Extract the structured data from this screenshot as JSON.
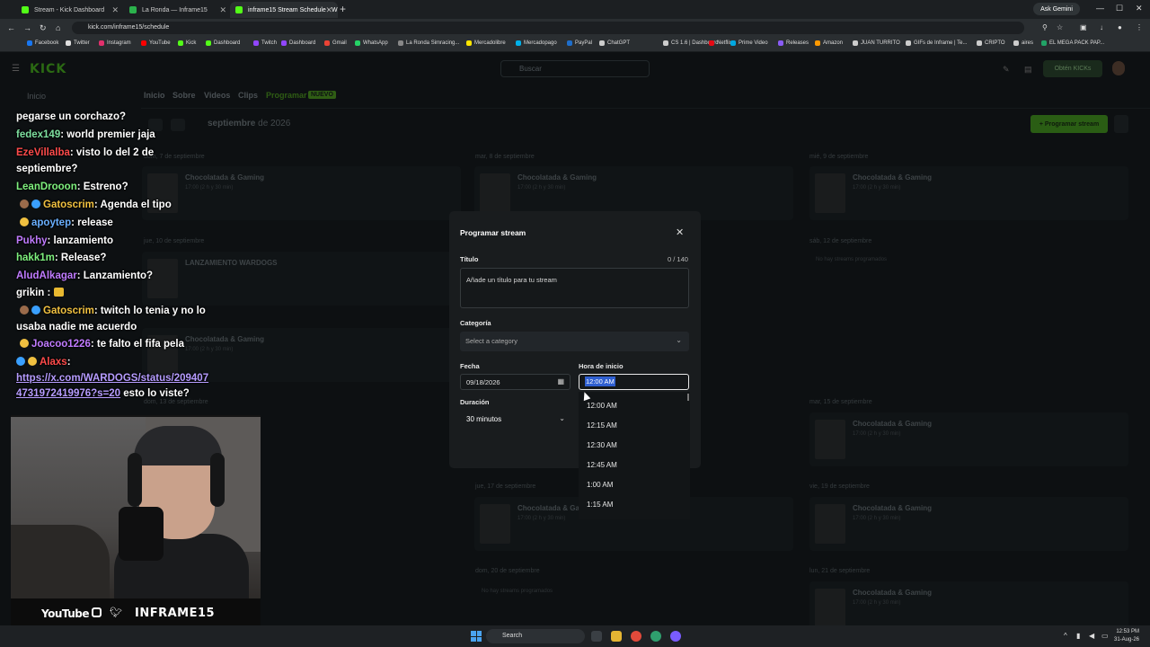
{
  "browser": {
    "tabs": [
      {
        "label": "Stream - Kick Dashboard"
      },
      {
        "label": "La Ronda — Inframe15"
      },
      {
        "label": "inframe15 Stream Schedule - W"
      }
    ],
    "gemini_label": "Ask Gemini",
    "url": "kick.com/inframe15/schedule",
    "bookmarks": [
      {
        "label": "Facebook",
        "color": "#1877f2"
      },
      {
        "label": "Twitter",
        "color": "#dddddd"
      },
      {
        "label": "Instagram",
        "color": "#e1306c"
      },
      {
        "label": "YouTube",
        "color": "#ff0000"
      },
      {
        "label": "Kick",
        "color": "#53fc18"
      },
      {
        "label": "Dashboard",
        "color": "#53fc18"
      },
      {
        "label": "Twitch",
        "color": "#9146ff"
      },
      {
        "label": "Dashboard",
        "color": "#9146ff"
      },
      {
        "label": "Gmail",
        "color": "#ea4335"
      },
      {
        "label": "WhatsApp",
        "color": "#25d366"
      },
      {
        "label": "La Ronda Simracing...",
        "color": "#888888"
      },
      {
        "label": "Mercadolibre",
        "color": "#ffe600"
      },
      {
        "label": "Mercadopago",
        "color": "#00b1ea"
      },
      {
        "label": "PayPal",
        "color": "#1e6ecb"
      },
      {
        "label": "ChatGPT",
        "color": "#cccccc"
      },
      {
        "label": "CS 1.6 | Dashboard",
        "color": "#cccccc"
      },
      {
        "label": "Netflix",
        "color": "#e50914"
      },
      {
        "label": "Prime Video",
        "color": "#00a8e1"
      },
      {
        "label": "Releases",
        "color": "#8a5cf6"
      },
      {
        "label": "Amazon",
        "color": "#ff9900"
      },
      {
        "label": "JUAN TURRITO",
        "color": "#cccccc"
      },
      {
        "label": "GIFs de Inframe | Te...",
        "color": "#cccccc"
      },
      {
        "label": "CRIPTO",
        "color": "#cccccc"
      },
      {
        "label": "aires",
        "color": "#cccccc"
      },
      {
        "label": "EL MEGA PACK PAP...",
        "color": "#21a366"
      }
    ]
  },
  "kick": {
    "logo": "KICK",
    "search_placeholder": "Buscar",
    "get_kicks": "Obtén KICKs",
    "sidebar_home": "Inicio",
    "nav": [
      "Inicio",
      "Sobre",
      "Videos",
      "Clips",
      "Programar"
    ],
    "nav_badge": "NUEVO",
    "month": "septiembre",
    "year": "de 2026",
    "program_button": "+ Programar stream",
    "days": [
      {
        "label": "dom, 7 de septiembre"
      },
      {
        "label": "mar, 8 de septiembre"
      },
      {
        "label": "mié, 9 de septiembre"
      },
      {
        "label": "jue, 10 de septiembre"
      },
      {
        "label": "sáb, 12 de septiembre"
      },
      {
        "label": "dom, 13 de septiembre"
      },
      {
        "label": "mar, 15 de septiembre"
      },
      {
        "label": "jue, 17 de septiembre"
      },
      {
        "label": "vie, 19 de septiembre"
      },
      {
        "label": "dom, 20 de septiembre"
      },
      {
        "label": "lun, 21 de septiembre"
      }
    ],
    "event_title": "Chocolatada & Gaming",
    "event_sub": "17:00 (2 h y 30 min)",
    "event_wardogs": "LANZAMIENTO WARDOGS",
    "no_events": "No hay streams programados"
  },
  "chat": [
    {
      "user": "",
      "text": "pegarse un corchazo?",
      "color": "#ffffff"
    },
    {
      "user": "fedex149",
      "text": ": world premier jaja",
      "color": "#7ee0a0"
    },
    {
      "user": "EzeVillalba",
      "text": ": visto lo del 2 de",
      "color": "#ff4b4b"
    },
    {
      "user": "",
      "text": "septiembre?",
      "color": "#ffffff"
    },
    {
      "user": "LeanDrooon",
      "text": ": Estreno?",
      "color": "#7ef07e"
    },
    {
      "user": "Gatoscrim",
      "text": ": Agenda el tipo",
      "color": "#f0c040"
    },
    {
      "user": "apoytep",
      "text": ": release",
      "color": "#6ab0ff"
    },
    {
      "user": "Pukhy",
      "text": ": lanzamiento",
      "color": "#c07bff"
    },
    {
      "user": "hakk1m",
      "text": ": Release?",
      "color": "#7ef07e"
    },
    {
      "user": "AludAlkagar",
      "text": ": Lanzamiento?",
      "color": "#c07bff"
    },
    {
      "user": "grikin",
      "text": " :",
      "color": "#ffffff"
    },
    {
      "user": "Gatoscrim",
      "text": ": twitch lo tenia y no lo",
      "color": "#f0c040"
    },
    {
      "user": "",
      "text": "usaba nadie me acuerdo",
      "color": "#ffffff"
    },
    {
      "user": "Joacoo1226",
      "text": ": te falto el fifa pela",
      "color": "#c07bff"
    },
    {
      "user": "Alaxs",
      "text": ":",
      "color": "#ff4b4b"
    },
    {
      "user": "",
      "text": "https://x.com/WARDOGS/status/209407",
      "color": "#b69cff"
    },
    {
      "user": "",
      "text": "4731972419976?s=20",
      "color": "#b69cff",
      "suffix": " esto lo viste?"
    }
  ],
  "overlay": {
    "youtube": "YouTube",
    "handle": "INFRAME15"
  },
  "modal": {
    "title": "Programar stream",
    "title_label": "Título",
    "count": "0 / 140",
    "title_placeholder": "Añade un título para tu stream",
    "category_label": "Categoría",
    "category_placeholder": "Select a category",
    "date_label": "Fecha",
    "date_value": "09/18/2026",
    "time_label": "Hora de inicio",
    "time_value": "12:00 AM",
    "duration_label": "Duración",
    "duration_value": "30 minutos",
    "time_options": [
      "12:00 AM",
      "12:15 AM",
      "12:30 AM",
      "12:45 AM",
      "1:00 AM",
      "1:15 AM"
    ]
  },
  "taskbar": {
    "search": "Search",
    "time": "12:53 PM",
    "date": "31-Aug-26"
  }
}
